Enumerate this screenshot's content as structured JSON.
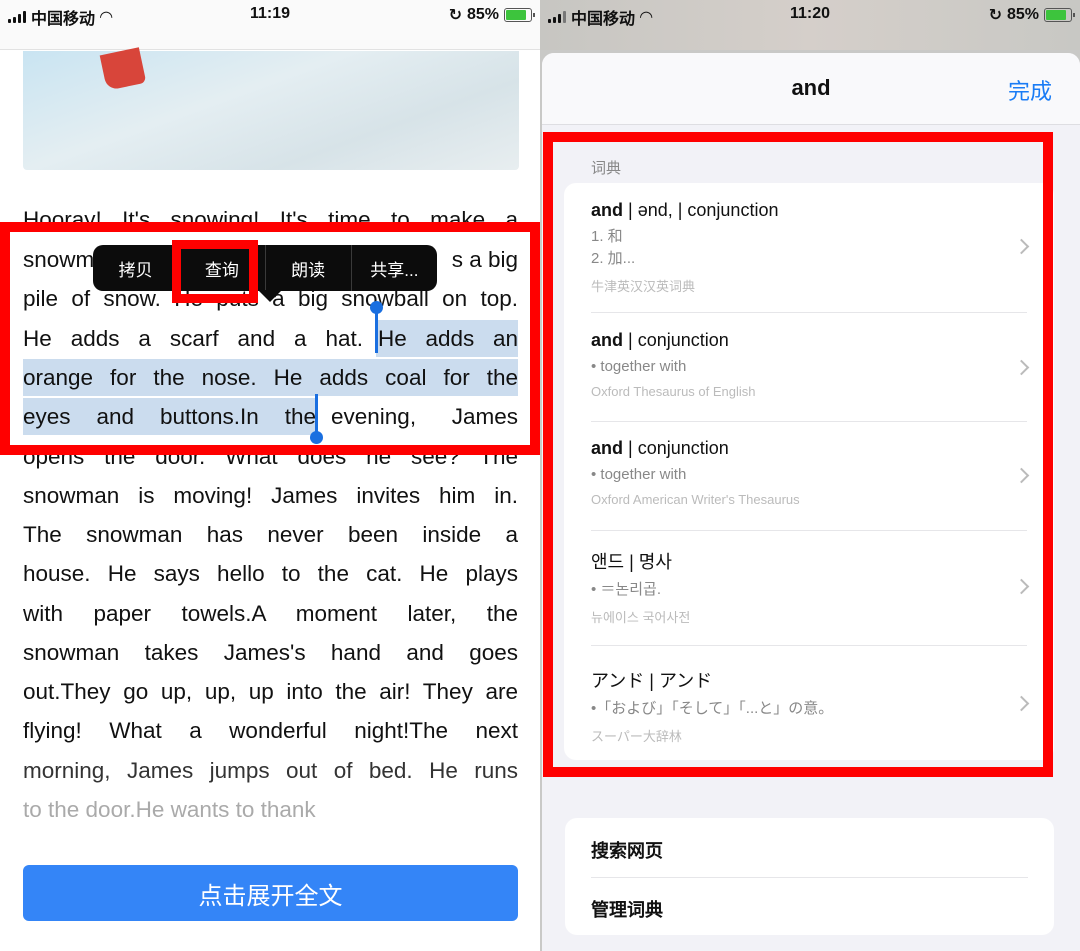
{
  "left": {
    "status": {
      "carrier": "中国移动",
      "time": "11:19",
      "battery": "85%",
      "battery_level": 85
    },
    "article_lines": [
      "Hooray! It's snowing! It's time to make a",
      "pile of snow. He puts a big snowball on top.",
      "He adds a scarf and a hat.",
      "He adds an",
      "orange for the nose. He adds coal for the",
      "eyes and buttons.In the",
      "evening, James",
      "opens the door. What does he see? The",
      "snowman is moving! James invites him in.",
      "The snowman has never been inside a",
      "house. He says hello to the cat. He plays",
      "with paper towels.A moment later, the",
      "snowman takes James's hand and goes",
      "out.They go up, up, up into the air! They are",
      "flying! What a wonderful night!The next",
      "morning, James jumps out of bed. He runs",
      "to the door.He wants to thank"
    ],
    "line2_left": "snowm",
    "line2_right": "s a big",
    "context_menu": [
      "拷贝",
      "查询",
      "朗读",
      "共享..."
    ],
    "expand_button": "点击展开全文",
    "accent": "#3485f7",
    "selection_color": "#cbdcee"
  },
  "right": {
    "status": {
      "carrier": "中国移动",
      "time": "11:20",
      "battery": "85%",
      "battery_level": 85
    },
    "title": "and",
    "done": "完成",
    "section_label": "词典",
    "entries": [
      {
        "title_bold": "and",
        "title_rest": " | ənd, | conjunction",
        "lines": [
          "1. 和",
          "2. 加..."
        ],
        "source": "牛津英汉汉英词典"
      },
      {
        "title_bold": "and",
        "title_rest": " | conjunction",
        "lines": [
          "• together with"
        ],
        "source": "Oxford Thesaurus of English"
      },
      {
        "title_bold": "and",
        "title_rest": " | conjunction",
        "lines": [
          "• together with"
        ],
        "source": "Oxford American Writer's Thesaurus"
      },
      {
        "title_bold": "",
        "title_rest": "앤드 | 명사",
        "lines": [
          "• ＝논리곱."
        ],
        "source": "뉴에이스 국어사전"
      },
      {
        "title_bold": "",
        "title_rest": "アンド | アンド",
        "lines": [
          "•「および」「そして」「...と」の意。"
        ],
        "source": "スーパー大辞林"
      }
    ],
    "actions": [
      "搜索网页",
      "管理词典"
    ],
    "accent": "#1a7cf5"
  },
  "annotation_color": "#ff0000"
}
